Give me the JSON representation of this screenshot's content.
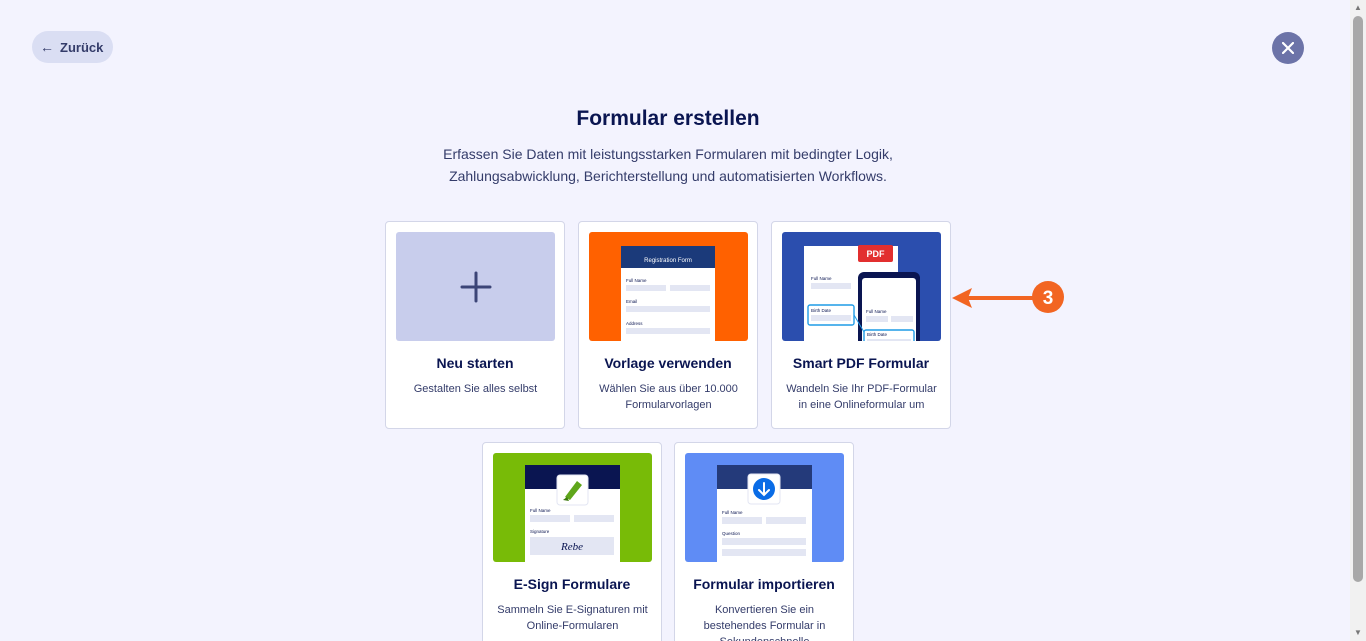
{
  "nav": {
    "back_label": "Zurück",
    "close_icon": "close-icon"
  },
  "header": {
    "title": "Formular erstellen",
    "subtitle_line1": "Erfassen Sie Daten mit leistungsstarken Formularen mit bedingter Logik,",
    "subtitle_line2": "Zahlungsabwicklung, Berichterstellung und automatisierten Workflows."
  },
  "cards": [
    {
      "title": "Neu starten",
      "desc": "Gestalten Sie alles selbst",
      "thumb_color": "#c8cdec"
    },
    {
      "title": "Vorlage verwenden",
      "desc": "Wählen Sie aus über 10.000 Formularvorlagen",
      "thumb_color": "#ff6100",
      "thumb_header": "Registration Form",
      "fields": [
        "Full Name",
        "Email",
        "Address"
      ]
    },
    {
      "title": "Smart PDF Formular",
      "desc": "Wandeln Sie Ihr PDF-Formular in eine Onlineformular um",
      "thumb_color": "#2b4eae",
      "pdf_badge": "PDF",
      "fields": [
        "Full Name",
        "Birth Date",
        "Full Name",
        "Birth Date"
      ]
    },
    {
      "title": "E-Sign Formulare",
      "desc": "Sammeln Sie E-Signaturen mit Online-Formularen",
      "thumb_color": "#78bb07",
      "fields": [
        "Full Name",
        "Signature"
      ],
      "signature": "Rebe"
    },
    {
      "title": "Formular importieren",
      "desc": "Konvertieren Sie ein bestehendes Formular in Sekundenschnelle",
      "thumb_color": "#5f8cf5",
      "fields": [
        "Full Name",
        "Question"
      ]
    }
  ],
  "annotation": {
    "number": "3",
    "color": "#f26522"
  }
}
